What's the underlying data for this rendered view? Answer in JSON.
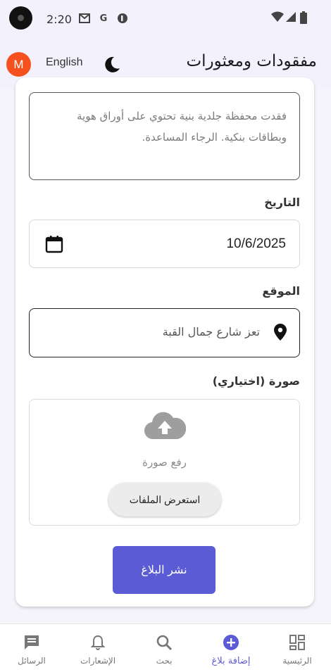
{
  "status_bar": {
    "time": "2:20",
    "notification_icons": [
      "gmail-icon",
      "google-icon",
      "app-icon"
    ],
    "system_icons": [
      "wifi-icon",
      "signal-icon",
      "battery-icon"
    ]
  },
  "app_bar": {
    "avatar_letter": "M",
    "language_button": "English",
    "theme_icon": "moon-icon",
    "title": "مفقودات ومعثورات"
  },
  "form": {
    "description_value": "فقدت محفظة جلدية بنية تحتوي على أوراق هوية وبطاقات بنكية. الرجاء المساعدة.",
    "date_label": "التاريخ",
    "date_value": "10/6/2025",
    "location_label": "الموقع",
    "location_value": "تعز شارع جمال القبة",
    "image_label": "صورة (اختياري)",
    "upload_text": "رفع صورة",
    "browse_button": "استعرض الملفات",
    "publish_button": "نشر البلاغ"
  },
  "bottom_nav": {
    "items": [
      {
        "label": "الرئيسية",
        "icon": "dashboard-icon",
        "active": false
      },
      {
        "label": "إضافة بلاغ",
        "icon": "add-circle-icon",
        "active": true
      },
      {
        "label": "بحث",
        "icon": "search-icon",
        "active": false
      },
      {
        "label": "الإشعارات",
        "icon": "bell-icon",
        "active": false
      },
      {
        "label": "الرسائل",
        "icon": "chat-icon",
        "active": false
      }
    ]
  },
  "colors": {
    "accent": "#5b5bd6",
    "avatar": "#f4511e",
    "app_bar_bg": "#f3f1fb"
  }
}
